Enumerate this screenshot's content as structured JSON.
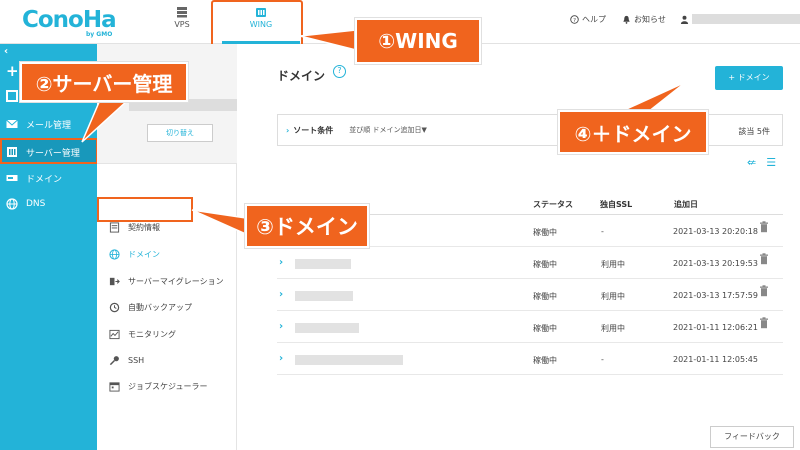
{
  "header": {
    "logo_text": "ConoHa",
    "logo_sub": "by GMO",
    "tabs": [
      {
        "label": "VPS"
      },
      {
        "label": "WING"
      }
    ],
    "help": "ヘルプ",
    "news": "お知らせ"
  },
  "sidebar": {
    "items": [
      {
        "label": "メール管理"
      },
      {
        "label": "サーバー管理"
      },
      {
        "label": "ドメイン"
      },
      {
        "label": "DNS"
      }
    ]
  },
  "subside": {
    "switch_label": "切り替え",
    "menu": [
      {
        "label": "契約情報"
      },
      {
        "label": "ドメイン"
      },
      {
        "label": "サーバーマイグレーション"
      },
      {
        "label": "自動バックアップ"
      },
      {
        "label": "モニタリング"
      },
      {
        "label": "SSH"
      },
      {
        "label": "ジョブスケジューラー"
      }
    ]
  },
  "main": {
    "title": "ドメイン",
    "add_button": "+ ドメイン",
    "sort_label": "ソート条件",
    "sort_order": "並び順  ドメイン追加日▼",
    "count": "該当 5件",
    "columns": {
      "status": "ステータス",
      "ssl": "独自SSL",
      "date": "追加日"
    },
    "rows": [
      {
        "status": "稼働中",
        "ssl": "-",
        "date": "2021-03-13 20:20:18"
      },
      {
        "status": "稼働中",
        "ssl": "利用中",
        "date": "2021-03-13 20:19:53"
      },
      {
        "status": "稼働中",
        "ssl": "利用中",
        "date": "2021-03-13 17:57:59"
      },
      {
        "status": "稼働中",
        "ssl": "利用中",
        "date": "2021-01-11 12:06:21"
      },
      {
        "status": "稼働中",
        "ssl": "-",
        "date": "2021-01-11 12:05:45"
      }
    ]
  },
  "feedback": "フィードバック",
  "callouts": {
    "c1": "①WING",
    "c2": "②サーバー管理",
    "c3": "③ドメイン",
    "c4": "④＋ドメイン"
  },
  "colors": {
    "accent": "#23b3d8",
    "callout": "#f0641e"
  },
  "icons": [
    "vps-icon",
    "wing-icon",
    "help-icon",
    "bell-icon",
    "user-icon",
    "trash-icon"
  ]
}
